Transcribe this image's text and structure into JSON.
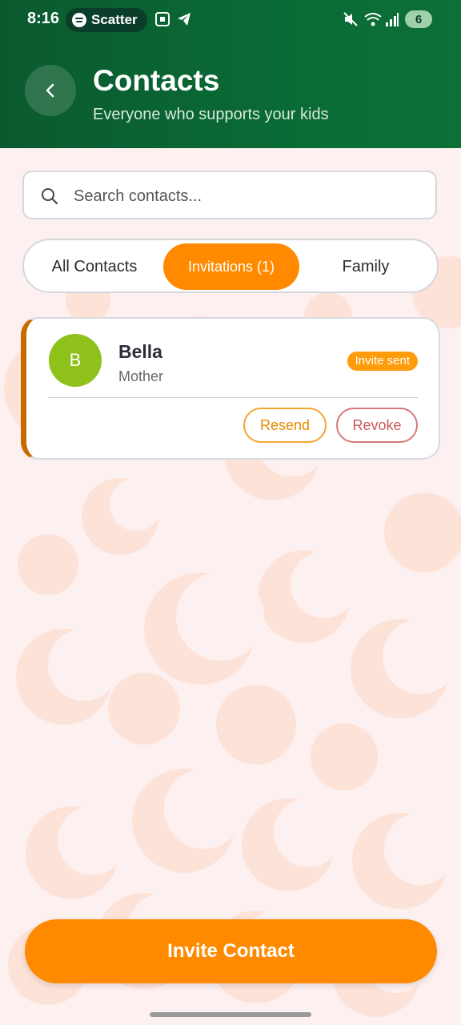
{
  "status_bar": {
    "time": "8:16",
    "media_pill_label": "Scatter",
    "battery_level": "6"
  },
  "header": {
    "title": "Contacts",
    "subtitle": "Everyone who supports your kids",
    "back_icon": "chevron-left-icon"
  },
  "search": {
    "placeholder": "Search contacts...",
    "value": ""
  },
  "tabs": [
    {
      "label": "All Contacts",
      "active": false
    },
    {
      "label": "Invitations (1)",
      "active": true
    },
    {
      "label": "Family",
      "active": false
    }
  ],
  "contacts": [
    {
      "initial": "B",
      "name": "Bella",
      "relation": "Mother",
      "status": "Invite sent",
      "actions": {
        "resend": "Resend",
        "revoke": "Revoke"
      }
    }
  ],
  "primary_action": {
    "label": "Invite Contact"
  },
  "colors": {
    "header_green": "#0a6a35",
    "accent_orange": "#ff8a00",
    "avatar_green": "#8ec11a",
    "revoke_red": "#c9585a",
    "card_left_bar": "#c96a00"
  }
}
